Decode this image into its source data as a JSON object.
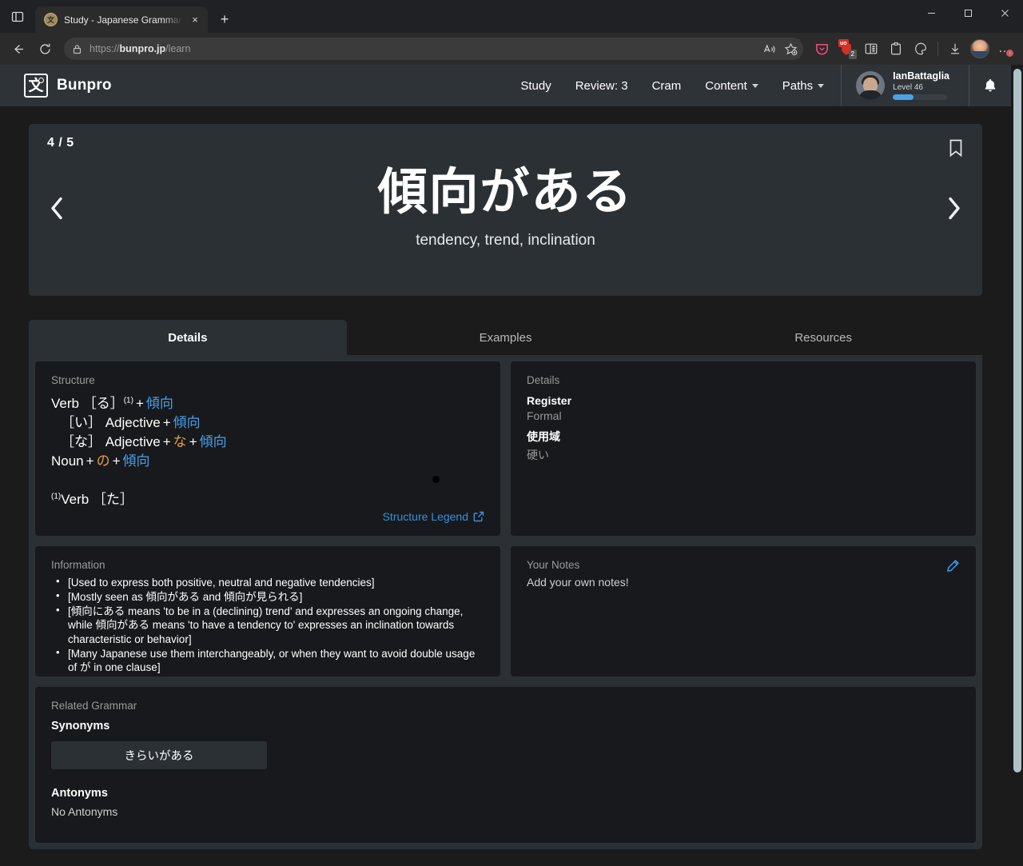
{
  "browser": {
    "tab": {
      "title": "Study - Japanese Grammar Expla",
      "favicon": "bunpro-favicon",
      "close": "×"
    },
    "newtab_label": "+",
    "window": {
      "minimize": "–",
      "maximize": "▢",
      "close": "✕"
    },
    "toolbar": {
      "back": "←",
      "reload": "⟳",
      "url_prefix": "https://",
      "url_domain": "bunpro.jp",
      "url_path": "/learn",
      "read_aloud": "A",
      "add_favorite": "☆",
      "extensions": [
        {
          "name": "pocket-extension",
          "badge": ""
        },
        {
          "name": "ublock-origin-extension",
          "badge": "2",
          "label": "uo"
        },
        {
          "name": "collections-icon",
          "badge": ""
        },
        {
          "name": "clipboard-icon",
          "badge": ""
        },
        {
          "name": "browser-essentials-icon",
          "badge": ""
        }
      ],
      "downloads": "↓",
      "profile": "profile-avatar",
      "settings_more": "…"
    }
  },
  "site": {
    "brand": {
      "logo_char": "文",
      "name": "Bunpro"
    },
    "nav": [
      {
        "label": "Study",
        "dropdown": false
      },
      {
        "label": "Review: 3",
        "dropdown": false
      },
      {
        "label": "Cram",
        "dropdown": false
      },
      {
        "label": "Content",
        "dropdown": true
      },
      {
        "label": "Paths",
        "dropdown": true
      }
    ],
    "user": {
      "name": "IanBattaglia",
      "level": "Level 46",
      "progress_pct": 38
    },
    "notifications": "bell-icon"
  },
  "hero": {
    "counter": "4 / 5",
    "bookmark": "bookmark-icon",
    "prev": "‹",
    "next": "›",
    "term": "傾向がある",
    "meaning": "tendency, trend, inclination"
  },
  "tabs": [
    {
      "label": "Details",
      "active": true
    },
    {
      "label": "Examples",
      "active": false
    },
    {
      "label": "Resources",
      "active": false
    }
  ],
  "structure": {
    "label": "Structure",
    "lines": [
      {
        "parts": [
          {
            "t": "Verb ［る］",
            "c": "white"
          },
          {
            "t": "(1)",
            "c": "sup"
          },
          {
            "t": "+",
            "c": "plus"
          },
          {
            "t": "傾向",
            "c": "blue"
          }
        ]
      },
      {
        "indent": true,
        "parts": [
          {
            "t": "［い］ Adjective",
            "c": "white"
          },
          {
            "t": "+",
            "c": "plus"
          },
          {
            "t": "傾向",
            "c": "blue"
          }
        ]
      },
      {
        "indent": true,
        "parts": [
          {
            "t": "［な］ Adjective",
            "c": "white"
          },
          {
            "t": "+",
            "c": "plus"
          },
          {
            "t": "な",
            "c": "orange"
          },
          {
            "t": "+",
            "c": "plus"
          },
          {
            "t": "傾向",
            "c": "blue"
          }
        ]
      },
      {
        "parts": [
          {
            "t": "Noun",
            "c": "white"
          },
          {
            "t": "+",
            "c": "plus"
          },
          {
            "t": "の",
            "c": "orange"
          },
          {
            "t": "+",
            "c": "plus"
          },
          {
            "t": "傾向",
            "c": "blue"
          }
        ]
      }
    ],
    "footnote_sup": "(1)",
    "footnote": "Verb ［た］",
    "legend_link": "Structure Legend",
    "legend_icon": "external-link-icon"
  },
  "details": {
    "label": "Details",
    "rows": [
      {
        "key": "Register",
        "value": "Formal"
      },
      {
        "key": "使用域",
        "value": "硬い"
      }
    ]
  },
  "information": {
    "label": "Information",
    "items": [
      "[Used to express both positive, neutral and negative tendencies]",
      "[Mostly seen as 傾向がある and 傾向が見られる]",
      "[傾向にある means 'to be in a (declining) trend' and expresses an ongoing change, while 傾向がある means 'to have a tendency to' expresses an inclination towards characteristic or behavior]",
      "[Many Japanese use them interchangeably, or when they want to avoid double usage of が in one clause]"
    ]
  },
  "notes": {
    "label": "Your Notes",
    "placeholder": "Add your own notes!",
    "edit_icon": "pencil-icon"
  },
  "related": {
    "label": "Related Grammar",
    "synonyms_heading": "Synonyms",
    "synonyms": [
      "きらいがある"
    ],
    "antonyms_heading": "Antonyms",
    "antonyms_empty": "No Antonyms"
  },
  "colors": {
    "page_bg": "#1b1b1b",
    "panel_bg": "#2b3035",
    "card_bg": "#17191c",
    "accent_blue": "#4a9fe8",
    "accent_orange": "#eb9f3e",
    "link_blue": "#3b8fdd",
    "header_bg": "#2e3338",
    "scrollbar_thumb": "#b0c2c8"
  }
}
